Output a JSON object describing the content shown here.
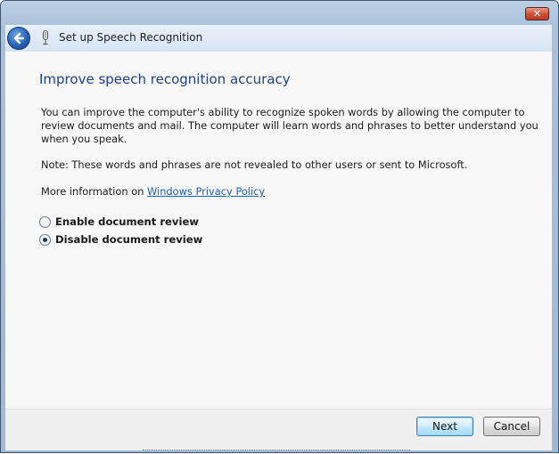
{
  "window": {
    "title": "Set up Speech Recognition",
    "close_label": "✕"
  },
  "main": {
    "heading": "Improve speech recognition accuracy",
    "paragraph1": "You can improve the computer's ability to recognize spoken words by allowing the computer to review documents and mail. The computer will learn words and phrases to better understand you when you speak.",
    "paragraph2": "Note: These words and phrases are not revealed to other users or sent to Microsoft.",
    "more_info_prefix": "More information on ",
    "privacy_link": "Windows Privacy Policy",
    "options": [
      {
        "label": "Enable document review",
        "selected": false
      },
      {
        "label": "Disable document review",
        "selected": true
      }
    ]
  },
  "footer": {
    "next_label": "Next",
    "cancel_label": "Cancel"
  },
  "icons": {
    "back": "back-arrow-icon",
    "mic": "microphone-icon",
    "close": "close-icon"
  }
}
